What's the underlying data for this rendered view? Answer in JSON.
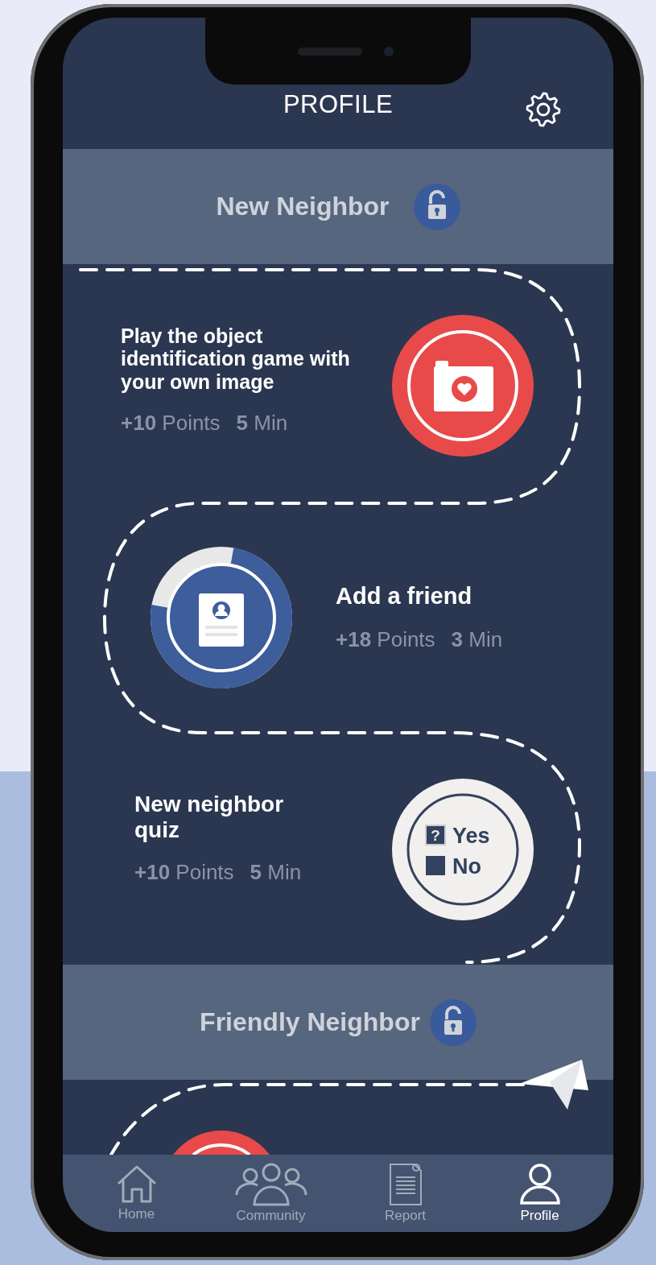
{
  "header": {
    "title": "PROFILE"
  },
  "level_1": {
    "title": "New Neighbor"
  },
  "tasks": [
    {
      "kind": "camera",
      "title": "Play the object identification game with your own image",
      "points": "**+10** Points",
      "time": "**5** Min"
    },
    {
      "kind": "profile",
      "title": "Add a friend",
      "points": "**+18** Points",
      "time": "**3** Min",
      "level": 0.75
    },
    {
      "kind": "quiz",
      "title": "New neighbor quiz",
      "points": "**+10** Points",
      "time": "**5** Min",
      "options": [
        {
          "symbol": "?",
          "label": "Yes"
        },
        {
          "label": "No"
        }
      ]
    }
  ],
  "level_2": {
    "title": "Friendly Neighbor"
  },
  "nav": [
    {
      "kind": "home",
      "label": "Home",
      "selected": false
    },
    {
      "kind": "community",
      "label": "Community",
      "selected": false
    },
    {
      "kind": "report",
      "label": "Report",
      "selected": false
    },
    {
      "kind": "profile",
      "label": "Profile",
      "selected": true
    }
  ]
}
